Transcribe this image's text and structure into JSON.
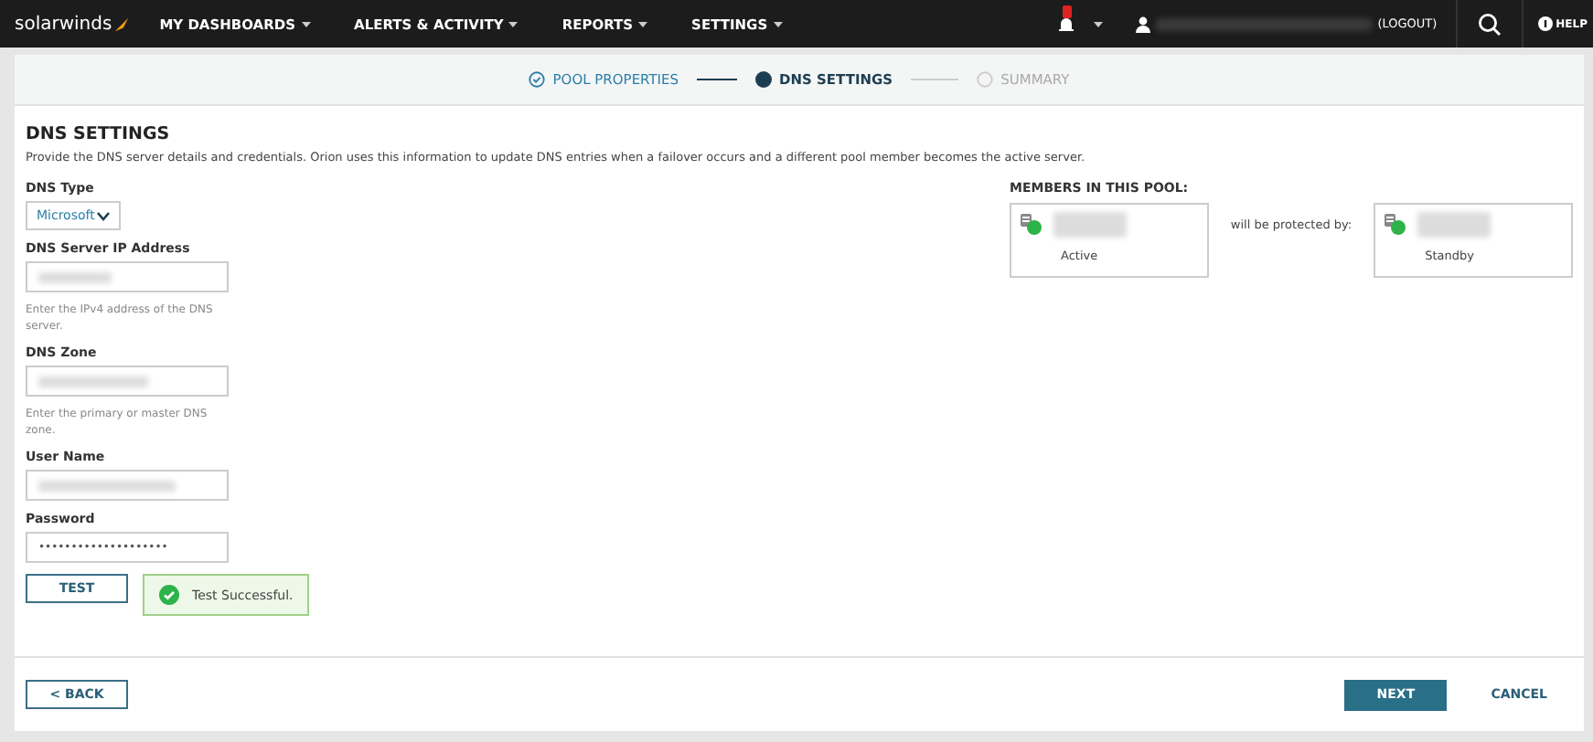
{
  "topbar": {
    "logo": "solarwinds",
    "menu": [
      {
        "label": "MY DASHBOARDS"
      },
      {
        "label": "ALERTS & ACTIVITY"
      },
      {
        "label": "REPORTS"
      },
      {
        "label": "SETTINGS"
      }
    ],
    "logout": "(LOGOUT)",
    "help": "HELP"
  },
  "steps": [
    {
      "label": "POOL PROPERTIES",
      "completed": true,
      "selected": false
    },
    {
      "label": "DNS SETTINGS",
      "completed": false,
      "selected": true
    },
    {
      "label": "SUMMARY",
      "completed": false,
      "selected": false
    }
  ],
  "title": "DNS SETTINGS",
  "description": "Provide the DNS server details and credentials. Orion uses this information to update DNS entries when a failover occurs and a different pool member becomes the active server.",
  "fields": [
    {
      "kind": "select",
      "label": "DNS Type",
      "value": "Microsoft"
    },
    {
      "kind": "redacted",
      "label": "DNS Server IP Address",
      "hint": "Enter the IPv4 address of the DNS server."
    },
    {
      "kind": "redacted",
      "label": "DNS Zone",
      "hint": "Enter the primary or master DNS zone."
    },
    {
      "kind": "redacted",
      "label": "User Name"
    },
    {
      "kind": "text",
      "label": "Password",
      "value": "••••••••••••••••••••"
    }
  ],
  "test_button": "TEST",
  "test_result": "Test Successful.",
  "members": {
    "title": "MEMBERS IN THIS POOL:",
    "connector": "will be protected by:",
    "items": [
      {
        "status": "Active"
      },
      {
        "status": "Standby"
      }
    ]
  },
  "footer": {
    "back": "< BACK",
    "next": "NEXT",
    "cancel": "CANCEL"
  }
}
